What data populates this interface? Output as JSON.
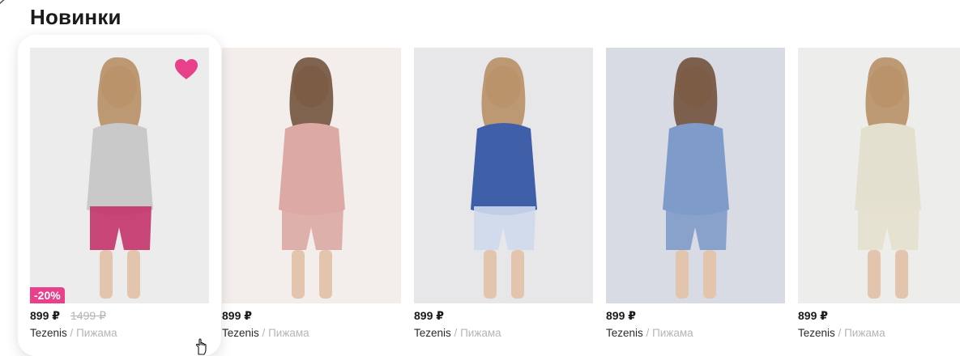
{
  "section": {
    "title": "Новинки"
  },
  "products": [
    {
      "price": "899 ₽",
      "old_price": "1499 ₽",
      "discount": "-20%",
      "brand": "Tezenis",
      "separator": "/",
      "category": "Пижама",
      "favorite": true,
      "photo_icon": "pajama-photo-grey-tank-shorts",
      "bg": "#ececec",
      "garment": "#c9c9c9",
      "accent": "#c4336a"
    },
    {
      "price": "899 ₽",
      "brand": "Tezenis",
      "separator": "/",
      "category": "Пижама",
      "photo_icon": "pajama-photo-pink-set",
      "bg": "#f3eeec",
      "garment": "#dca9a5",
      "accent": "#dca9a5"
    },
    {
      "price": "899 ₽",
      "brand": "Tezenis",
      "separator": "/",
      "category": "Пижама",
      "photo_icon": "pajama-photo-blue-tee-print-pants",
      "bg": "#e7e7e9",
      "garment": "#3f5fa8",
      "accent": "#cfd9ec"
    },
    {
      "price": "899 ₽",
      "brand": "Tezenis",
      "separator": "/",
      "category": "Пижама",
      "photo_icon": "pajama-photo-blue-satin-cami",
      "bg": "#d9dbe4",
      "garment": "#7e9bc9",
      "accent": "#7e9bc9"
    },
    {
      "price": "899 ₽",
      "brand": "Tezenis",
      "separator": "/",
      "category": "Пижама",
      "photo_icon": "pajama-photo-beige-shirt-shorts",
      "bg": "#ededeb",
      "garment": "#e4e0cf",
      "accent": "#e4e0cf"
    }
  ],
  "colors": {
    "accent_pink": "#e8408b",
    "muted_text": "#b5b5b5"
  },
  "icons": {
    "favorite": "heart-icon",
    "cursor": "hand-pointer-icon"
  }
}
